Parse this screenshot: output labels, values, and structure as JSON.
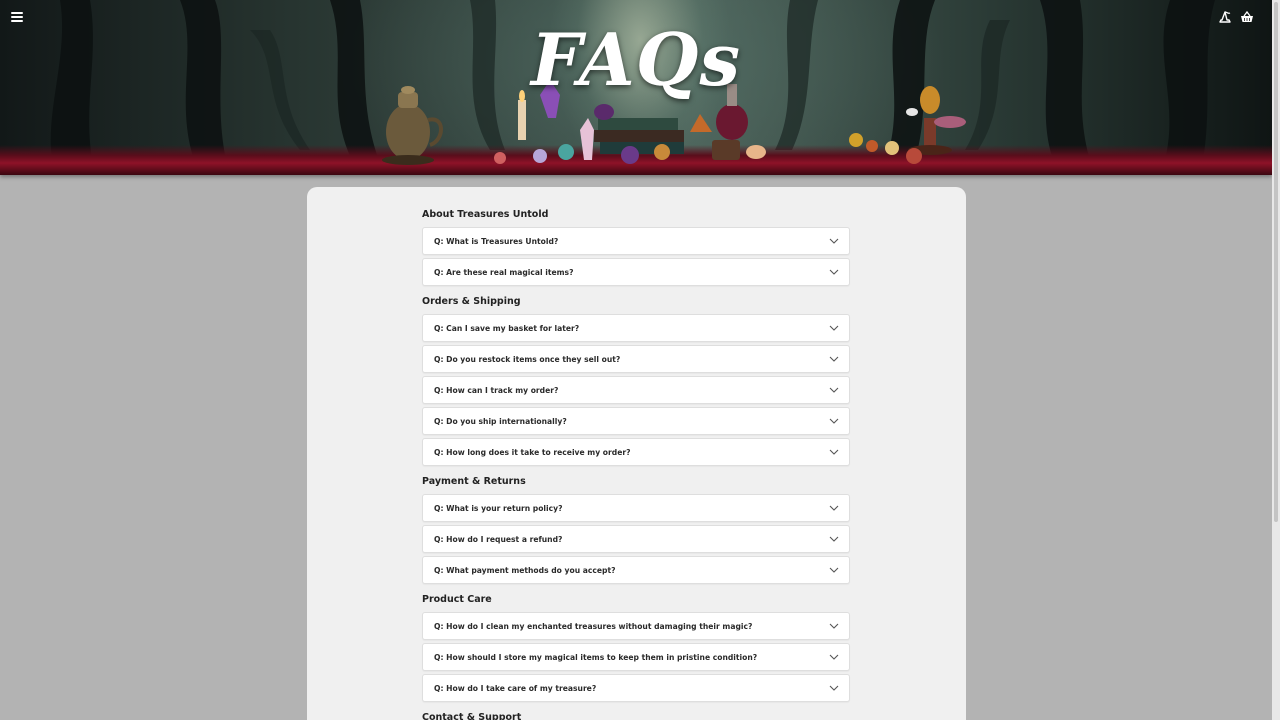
{
  "header": {
    "title": "FAQs",
    "menu_icon": "hamburger-menu-icon",
    "wizard_icon": "wizard-hat-icon",
    "basket_icon": "basket-icon"
  },
  "colors": {
    "page_background": "#b3b3b3",
    "card_background": "#f0f0f0",
    "item_background": "#ffffff",
    "text": "#222222"
  },
  "faq": {
    "sections": [
      {
        "title": "About Treasures Untold",
        "items": [
          "Q: What is Treasures Untold?",
          "Q: Are these real magical items?"
        ]
      },
      {
        "title": "Orders & Shipping",
        "items": [
          "Q: Can I save my basket for later?",
          "Q: Do you restock items once they sell out?",
          "Q: How can I track my order?",
          "Q: Do you ship internationally?",
          "Q: How long does it take to receive my order?"
        ]
      },
      {
        "title": "Payment & Returns",
        "items": [
          "Q: What is your return policy?",
          "Q: How do I request a refund?",
          "Q: What payment methods do you accept?"
        ]
      },
      {
        "title": "Product Care",
        "items": [
          "Q: How do I clean my enchanted treasures without damaging their magic?",
          "Q: How should I store my magical items to keep them in pristine condition?",
          "Q: How do I take care of my treasure?"
        ]
      },
      {
        "title": "Contact & Support",
        "items": []
      }
    ]
  }
}
